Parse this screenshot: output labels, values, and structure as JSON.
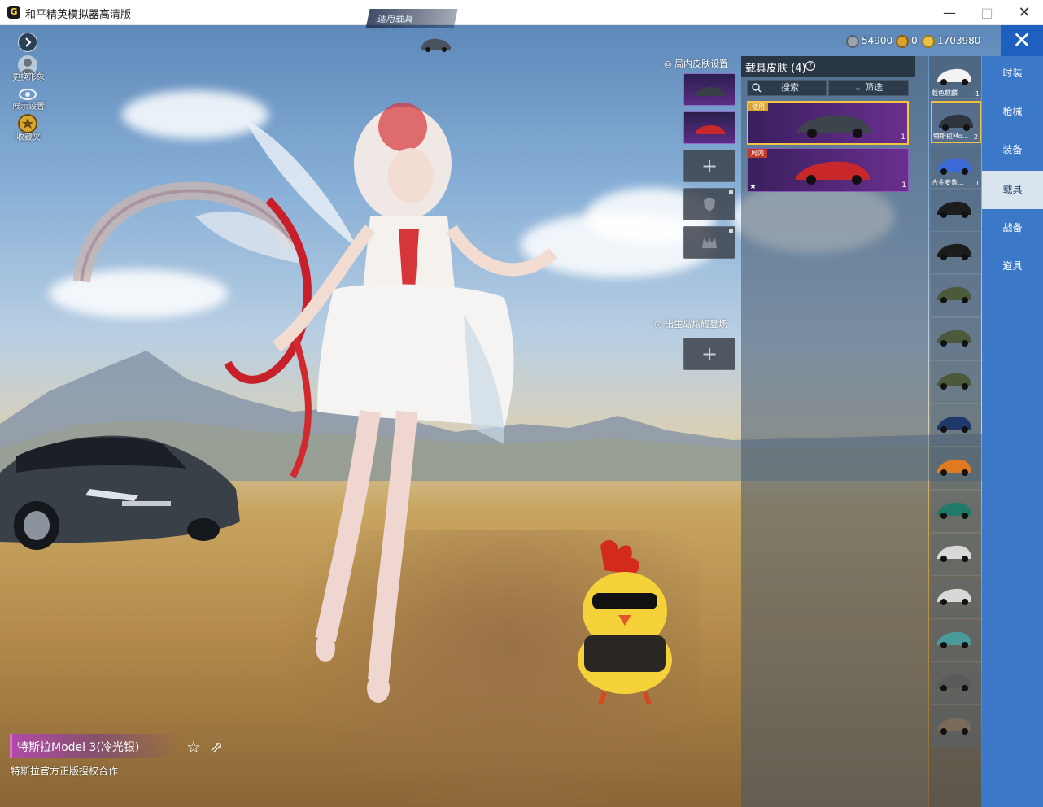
{
  "window": {
    "title": "和平精英模拟器高清版",
    "app_icon": "G",
    "min_glyph": "—",
    "max_glyph": "□",
    "close_glyph": "✕"
  },
  "topbar": {
    "vehicle_badge_label": "适用载具",
    "currencies": [
      {
        "icon": "silver-coin-icon",
        "value": "54900",
        "color": "#9aa3ad"
      },
      {
        "icon": "gold-coupon-icon",
        "value": "0",
        "color": "#d9a230"
      },
      {
        "icon": "gold-coin-icon",
        "value": "1703980",
        "color": "#e8c24a"
      }
    ],
    "close_glyph": "✕"
  },
  "left_menu": [
    {
      "label": "更换形象",
      "icon": "avatar-icon"
    },
    {
      "label": "展示设置",
      "icon": "eye-icon"
    },
    {
      "label": "收藏夹",
      "icon": "collection-icon"
    }
  ],
  "slots": {
    "ingame_skin_title": "局内皮肤设置",
    "spawn_title": "出生岛炫耀登场",
    "plus_glyph": "+"
  },
  "panel": {
    "title": "载具皮肤 (4)",
    "help_glyph": "?",
    "search_label": "搜索",
    "filter_label": "筛选",
    "cards": [
      {
        "tag": "使用",
        "tag_color": "#d9a230",
        "count": "1"
      },
      {
        "tag": "局内",
        "tag_color": "#c0392b",
        "count": "1"
      }
    ]
  },
  "vehicle_list": [
    {
      "label": "载色麒麟",
      "count": "1"
    },
    {
      "label": "特斯拉Mo...",
      "count": "2"
    },
    {
      "label": "合金麦鲁...",
      "count": "1"
    },
    {
      "label": "",
      "count": ""
    },
    {
      "label": "",
      "count": ""
    },
    {
      "label": "",
      "count": ""
    },
    {
      "label": "",
      "count": ""
    },
    {
      "label": "",
      "count": ""
    },
    {
      "label": "",
      "count": ""
    },
    {
      "label": "",
      "count": ""
    },
    {
      "label": "",
      "count": ""
    },
    {
      "label": "",
      "count": ""
    },
    {
      "label": "",
      "count": ""
    },
    {
      "label": "",
      "count": ""
    },
    {
      "label": "",
      "count": ""
    },
    {
      "label": "",
      "count": ""
    }
  ],
  "categories": [
    {
      "label": "时装"
    },
    {
      "label": "枪械"
    },
    {
      "label": "装备"
    },
    {
      "label": "载具"
    },
    {
      "label": "战备"
    },
    {
      "label": "道具"
    }
  ],
  "vehicle_info": {
    "name": "特斯拉Model 3(冷光银)",
    "description": "特斯拉官方正版授权合作",
    "star_glyph": "☆",
    "share_glyph": "⇗"
  },
  "colors": {
    "accent_blue": "#3c78c8",
    "selected_gold": "#f0c040",
    "skin_purple": "#6a2f8e"
  }
}
